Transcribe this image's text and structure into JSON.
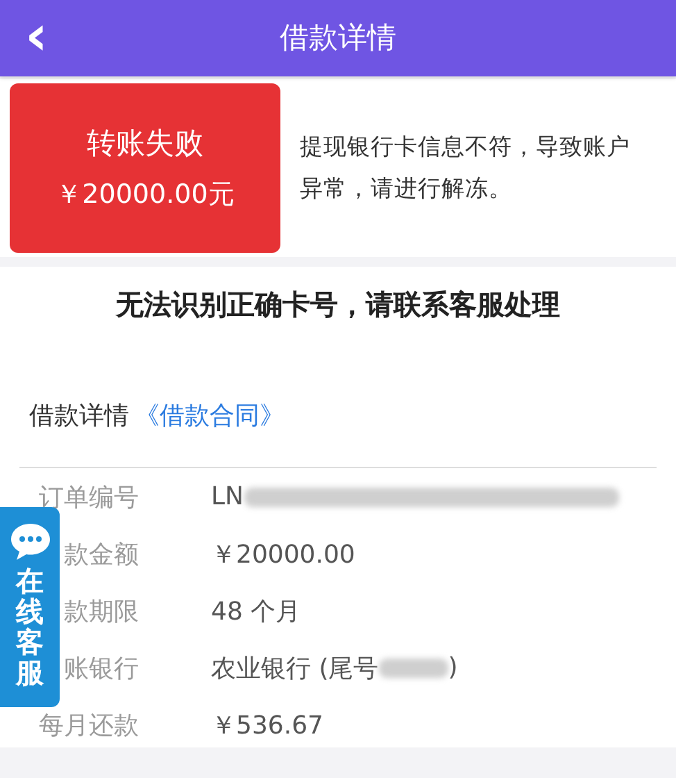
{
  "header": {
    "back_icon": "‹",
    "title": "借款详情"
  },
  "status": {
    "title": "转账失败",
    "amount": "￥20000.00元",
    "message": "提现银行卡信息不符，导致账户异常，请进行解冻。"
  },
  "notice": "无法识别正确卡号，请联系客服处理",
  "details": {
    "label": "借款详情",
    "contract_link": "《借款合同》",
    "rows": [
      {
        "label": "订单编号",
        "value": [
          {
            "kind": "text",
            "text": "LN"
          },
          {
            "kind": "blur"
          }
        ]
      },
      {
        "label": "款金额",
        "value": [
          {
            "kind": "text",
            "text": "￥20000.00"
          }
        ]
      },
      {
        "label": "款期限",
        "value": [
          {
            "kind": "text",
            "text": "48 个月"
          }
        ]
      },
      {
        "label": "账银行",
        "value": [
          {
            "kind": "text",
            "text": "农业银行 (尾号"
          },
          {
            "kind": "blur"
          },
          {
            "kind": "text",
            "text": ")"
          }
        ]
      },
      {
        "label": "每月还款",
        "value": [
          {
            "kind": "text",
            "text": "￥536.67"
          }
        ]
      }
    ]
  },
  "service_button": {
    "label": "在线客服"
  }
}
